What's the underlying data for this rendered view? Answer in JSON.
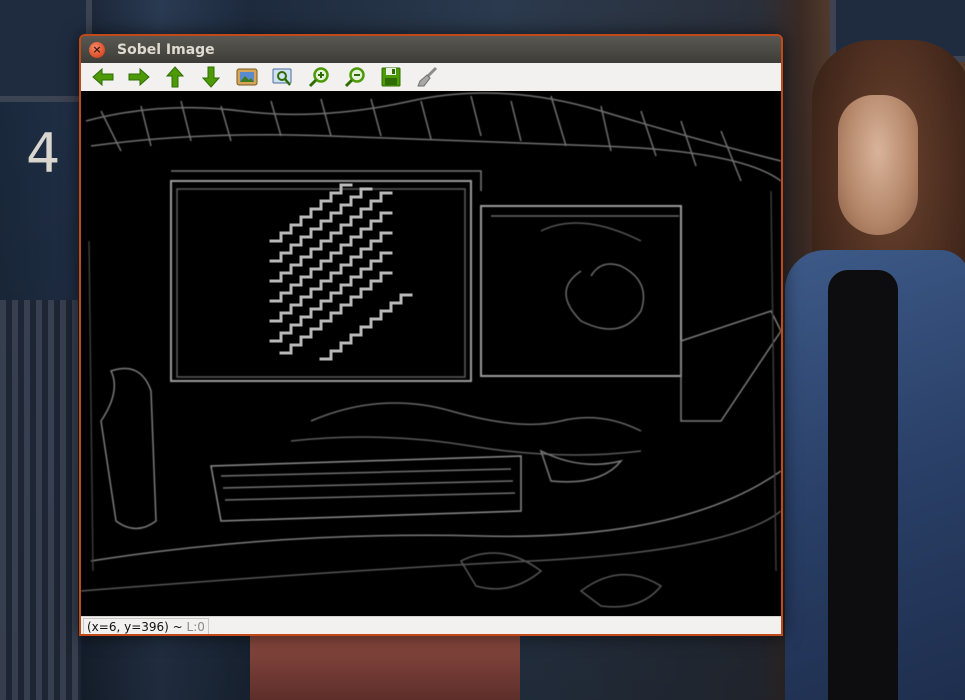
{
  "window": {
    "title": "Sobel Image"
  },
  "toolbar": {
    "buttons": [
      {
        "name": "pan-left",
        "icon": "arrow-left-icon"
      },
      {
        "name": "pan-right",
        "icon": "arrow-right-icon"
      },
      {
        "name": "pan-up",
        "icon": "arrow-up-icon"
      },
      {
        "name": "pan-down",
        "icon": "arrow-down-icon"
      },
      {
        "name": "zoom-fit",
        "icon": "image-fit-icon"
      },
      {
        "name": "zoom-original",
        "icon": "zoom-original-icon"
      },
      {
        "name": "zoom-in",
        "icon": "zoom-in-icon"
      },
      {
        "name": "zoom-out",
        "icon": "zoom-out-icon"
      },
      {
        "name": "save",
        "icon": "save-icon"
      },
      {
        "name": "properties",
        "icon": "brush-icon"
      }
    ]
  },
  "status": {
    "coords": "(x=6, y=396) ~ ",
    "level": "L:0"
  },
  "colors": {
    "accent_border": "#c24a1a",
    "icon_green": "#4e9a06",
    "canvas_bg": "#000000"
  }
}
